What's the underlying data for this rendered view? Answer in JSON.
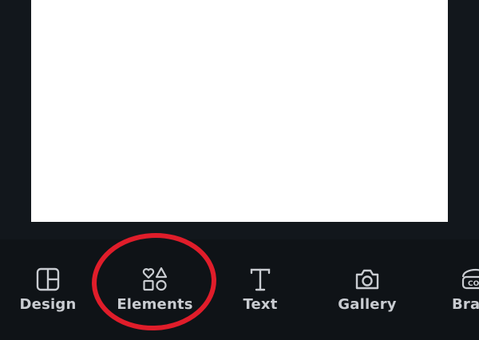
{
  "toolbar": {
    "items": [
      {
        "label": "Design",
        "icon": "layout-icon"
      },
      {
        "label": "Elements",
        "icon": "shapes-icon"
      },
      {
        "label": "Text",
        "icon": "text-icon"
      },
      {
        "label": "Gallery",
        "icon": "camera-icon"
      },
      {
        "label": "Bra",
        "icon": "brand-icon"
      }
    ]
  },
  "colors": {
    "background": "#0f1317",
    "canvas": "#ffffff",
    "tool_text": "#c9ccd1",
    "highlight": "#e01d2a"
  }
}
